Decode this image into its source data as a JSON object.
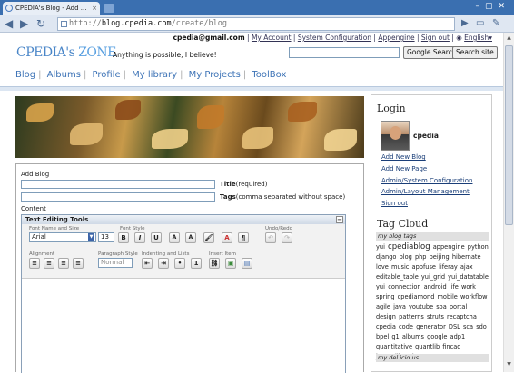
{
  "browser": {
    "tab_title": "CPEDIA's Blog - Add ...",
    "url_prefix": "http://",
    "url_host": "blog.cpedia.com",
    "url_path": "/create/blog"
  },
  "header": {
    "email": "cpedia@gmail.com",
    "links": [
      "My Account",
      "System Configuration",
      "Appengine",
      "Sign out"
    ],
    "language": "English▾",
    "logo_a": "CPEDIA",
    "logo_b": "'s ",
    "logo_c": "ZONE",
    "slogan": "Anything is possible, I believe!",
    "search_button": "Google Search",
    "search_site_button": "Search site"
  },
  "nav": [
    "Blog",
    "Albums",
    "Profile",
    "My library",
    "My Projects",
    "ToolBox"
  ],
  "form": {
    "heading": "Add Blog",
    "title_label": "Title",
    "title_hint": "(required)",
    "tags_label": "Tags",
    "tags_hint": "(comma separated without space)",
    "content_label": "Content"
  },
  "editor": {
    "title": "Text Editing Tools",
    "collapse": "−",
    "groups": {
      "font": "Font Name and Size",
      "style": "Font Style",
      "undo": "Undo/Redo",
      "align": "Alignment",
      "para": "Paragraph Style",
      "indent": "Indenting and Lists",
      "insert": "Insert Item"
    },
    "font_value": "Arial",
    "size_value": "13",
    "para_value": "Normal",
    "style_buttons": [
      "B",
      "I",
      "U",
      "A",
      "A",
      "🖌",
      "A",
      "¶"
    ]
  },
  "sidebar": {
    "login_heading": "Login",
    "username": "cpedia",
    "links": [
      "Add New Blog",
      "Add New Page",
      "Admin/System Configuration",
      "Admin/Layout Management",
      "Sign out"
    ],
    "tagcloud_heading": "Tag Cloud",
    "blog_tags_label": "my blog tags",
    "tags": [
      "yui",
      "cpediablog",
      "appengine",
      "python",
      "django",
      "blog",
      "php",
      "beijing",
      "hibernate",
      "love",
      "music",
      "appfuse",
      "liferay",
      "ajax",
      "editable_table",
      "yui_grid",
      "yui_datatable",
      "yui_connection",
      "android",
      "life",
      "work",
      "spring",
      "cpediamond",
      "mobile",
      "workflow",
      "agile",
      "java",
      "youtube",
      "soa",
      "portal",
      "design_patterns",
      "struts",
      "recaptcha",
      "cpedia",
      "code_generator",
      "DSL",
      "sca",
      "sdo",
      "bpel",
      "g1",
      "albums",
      "google",
      "adp1",
      "quantitative",
      "quantlib",
      "fincad",
      "jquantlib",
      "voice"
    ],
    "delicious_label": "my del.icio.us"
  },
  "colors": {
    "accent": "#3d73b6",
    "link": "#1a3e78",
    "titlebar": "#3a6fb0"
  }
}
